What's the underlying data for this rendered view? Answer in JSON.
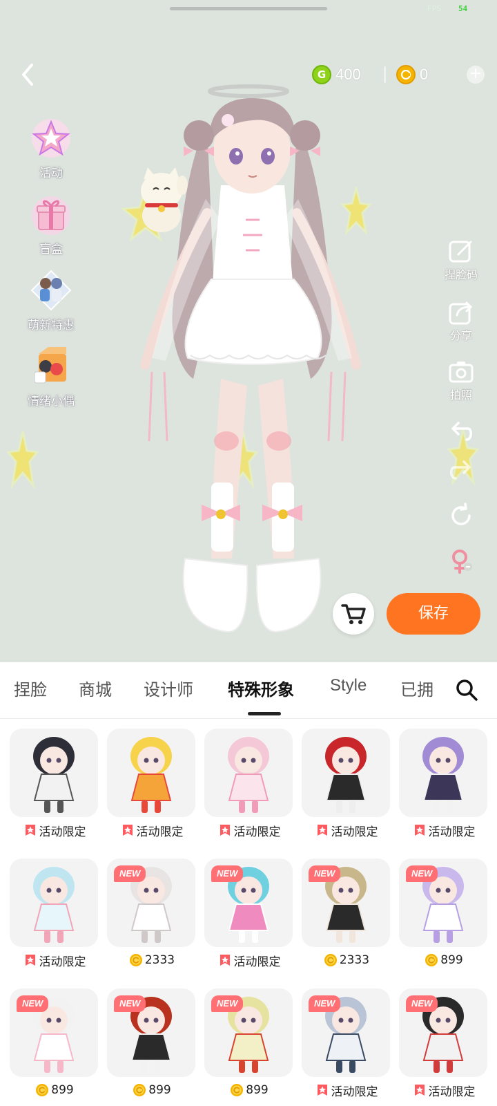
{
  "status": {
    "fps_label": "FPS",
    "fps_value": "54"
  },
  "currency": {
    "g_icon": "G",
    "g_amount": "400",
    "coin_amount": "0"
  },
  "left_menu": [
    {
      "label": "活动",
      "icon": "activity-star-icon"
    },
    {
      "label": "盲盒",
      "icon": "blind-box-gift-icon"
    },
    {
      "label": "萌新特惠",
      "icon": "newbie-offer-icon"
    },
    {
      "label": "情绪小偶",
      "icon": "emotion-doll-icon"
    }
  ],
  "right_tools": [
    {
      "label": "捏脸码",
      "icon": "face-code-icon"
    },
    {
      "label": "分享",
      "icon": "share-icon"
    },
    {
      "label": "拍照",
      "icon": "camera-icon"
    },
    {
      "label": "",
      "icon": "undo-icon"
    },
    {
      "label": "",
      "icon": "redo-icon"
    },
    {
      "label": "",
      "icon": "reset-icon"
    },
    {
      "label": "",
      "icon": "gender-switch-icon"
    }
  ],
  "save_label": "保存",
  "tabs": [
    {
      "label": "捏脸",
      "active": false
    },
    {
      "label": "商城",
      "active": false
    },
    {
      "label": "设计师",
      "active": false
    },
    {
      "label": "特殊形象",
      "active": true
    },
    {
      "label": "Style",
      "active": false
    },
    {
      "label": "已拥",
      "active": false
    }
  ],
  "items": [
    {
      "price": "活动限定",
      "price_type": "event",
      "is_new": false,
      "figure": "black-bunny-hood-girl"
    },
    {
      "price": "活动限定",
      "price_type": "event",
      "is_new": false,
      "figure": "blonde-twin-tail-girl"
    },
    {
      "price": "活动限定",
      "price_type": "event",
      "is_new": false,
      "figure": "pink-hair-girl"
    },
    {
      "price": "活动限定",
      "price_type": "event",
      "is_new": false,
      "figure": "red-cap-boy"
    },
    {
      "price": "活动限定",
      "price_type": "event",
      "is_new": false,
      "figure": "purple-bow-girl"
    },
    {
      "price": "活动限定",
      "price_type": "event",
      "is_new": false,
      "figure": "light-blue-hair-girl"
    },
    {
      "price": "2333",
      "price_type": "coin",
      "is_new": true,
      "figure": "white-outfit-girl"
    },
    {
      "price": "活动限定",
      "price_type": "event",
      "is_new": true,
      "figure": "pink-mecha-girl"
    },
    {
      "price": "2333",
      "price_type": "coin",
      "is_new": true,
      "figure": "black-jacket-girl"
    },
    {
      "price": "899",
      "price_type": "coin",
      "is_new": true,
      "figure": "lavender-princess"
    },
    {
      "price": "899",
      "price_type": "coin",
      "is_new": true,
      "figure": "white-crown-doll"
    },
    {
      "price": "899",
      "price_type": "coin",
      "is_new": true,
      "figure": "red-hair-queen"
    },
    {
      "price": "899",
      "price_type": "coin",
      "is_new": true,
      "figure": "blonde-crown-doll"
    },
    {
      "price": "活动限定",
      "price_type": "event",
      "is_new": true,
      "figure": "silver-mecha-warrior"
    },
    {
      "price": "活动限定",
      "price_type": "event",
      "is_new": true,
      "figure": "black-bob-girl"
    }
  ],
  "new_badge": "NEW",
  "colors": {
    "accent": "#ff7420",
    "event_tag": "#ff5a5f",
    "coin": "#f5b400",
    "g_coin": "#8fd21a",
    "stage_bg": "#dde3dd"
  }
}
